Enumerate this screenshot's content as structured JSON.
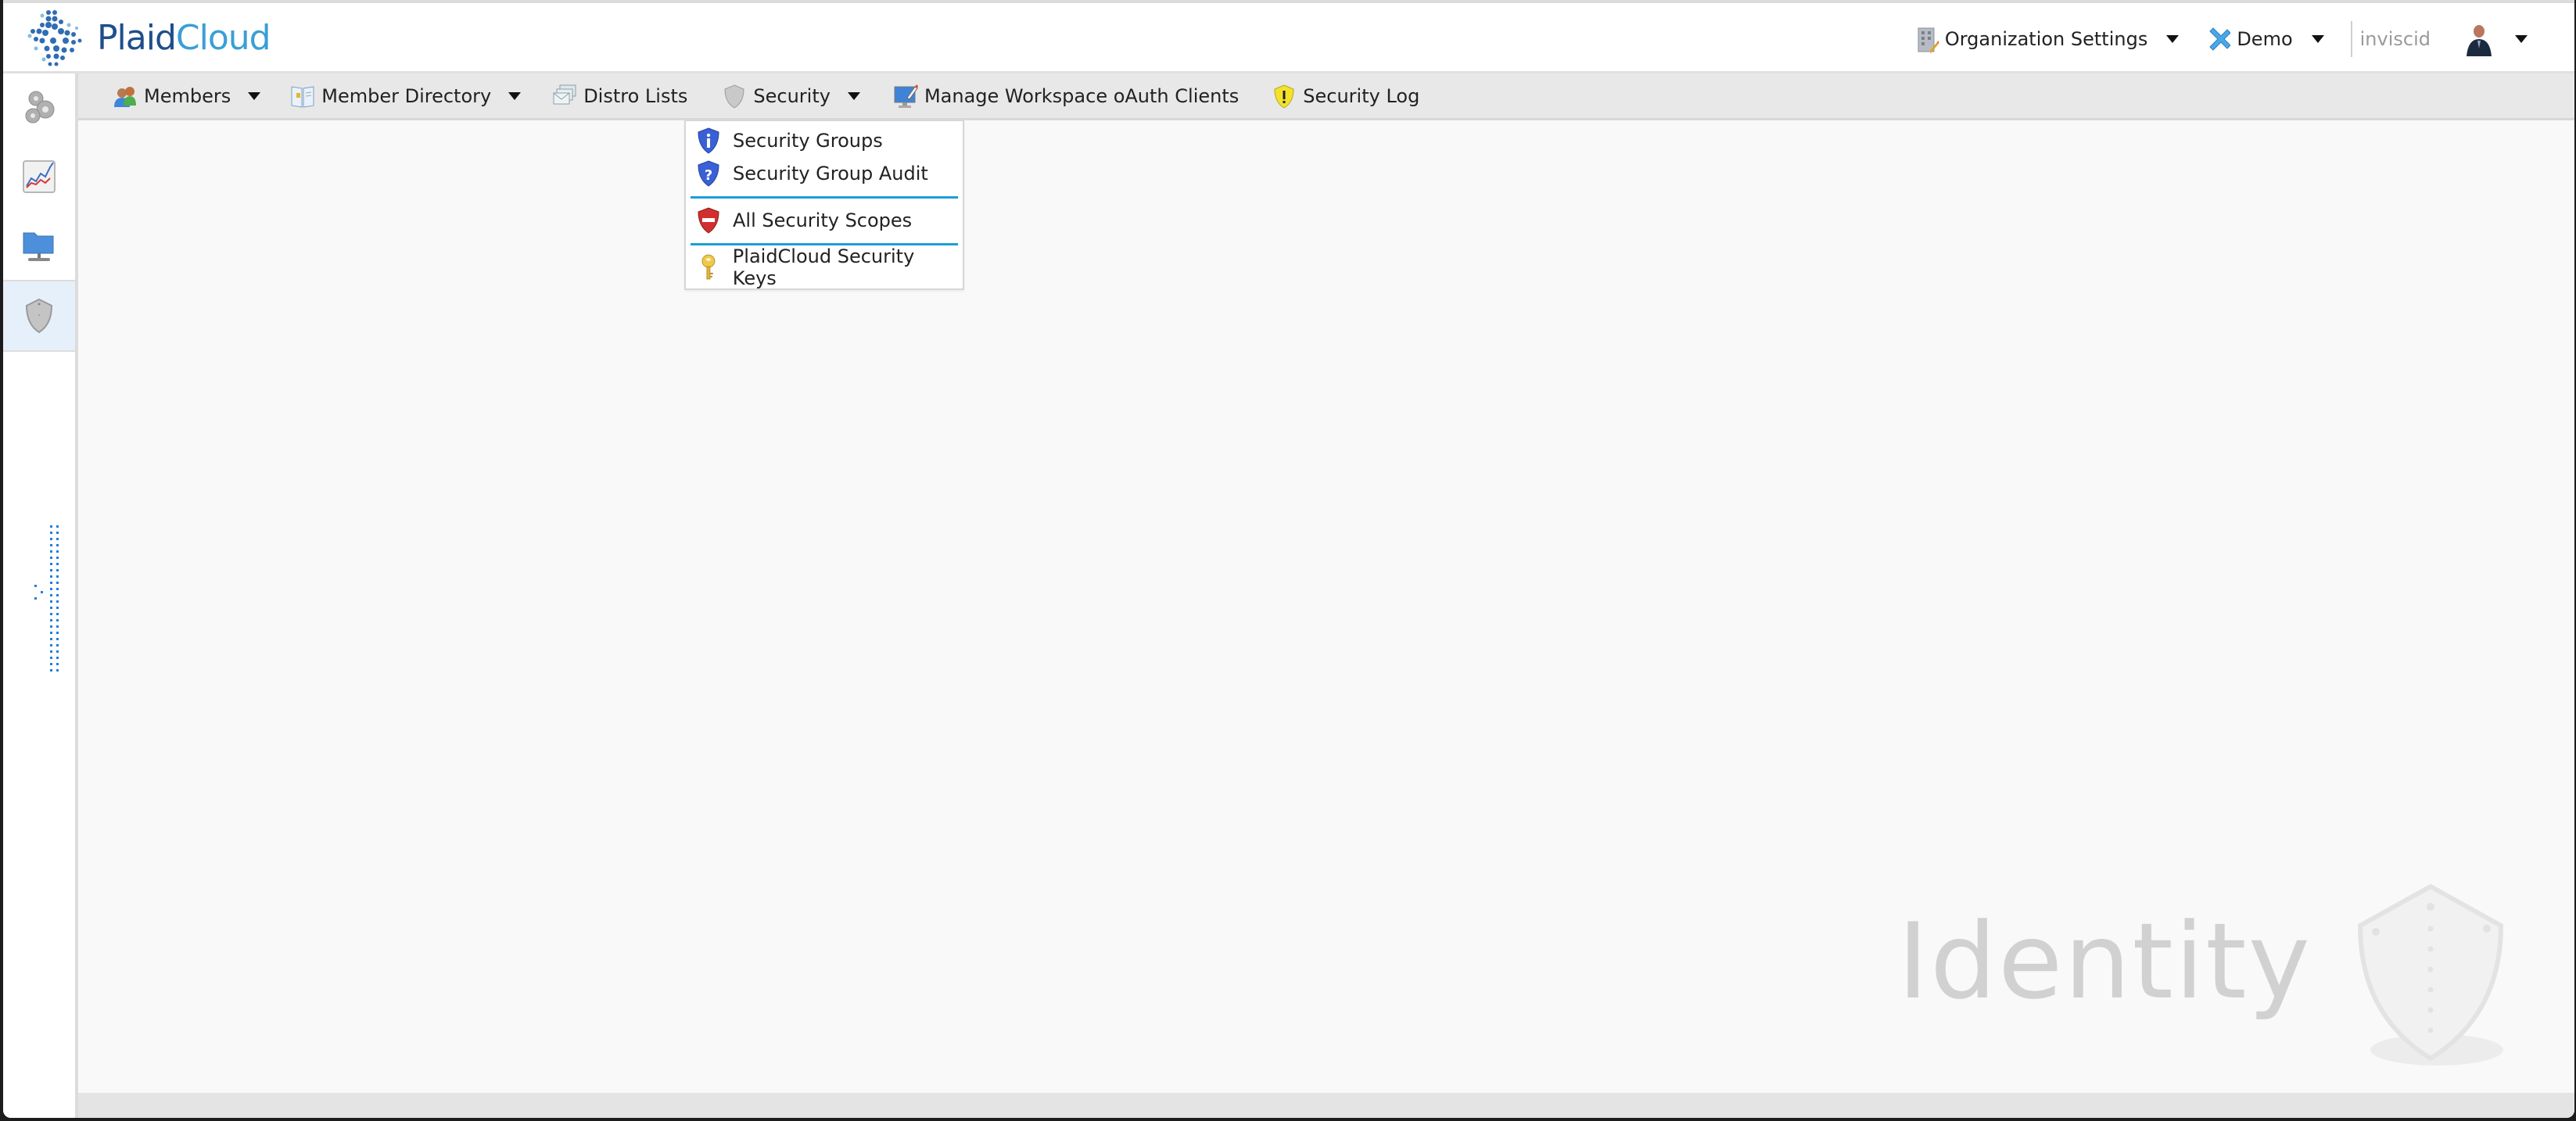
{
  "header": {
    "logo": {
      "part1": "Plaid",
      "part2": "Cloud",
      "icon": "plaidcloud-logo-icon"
    },
    "org_settings": {
      "label": "Organization Settings",
      "icon": "building-edit-icon"
    },
    "workspace": {
      "label": "Demo",
      "icon": "workspace-icon"
    },
    "user": {
      "name": "inviscid",
      "avatar": "user-avatar"
    }
  },
  "sidebar": {
    "items": [
      {
        "name": "settings",
        "icon": "gears-icon",
        "active": false
      },
      {
        "name": "analytics",
        "icon": "chart-icon",
        "active": false
      },
      {
        "name": "document",
        "icon": "network-folder-icon",
        "active": false
      },
      {
        "name": "identity",
        "icon": "shield-icon",
        "active": true
      }
    ]
  },
  "toolbar": {
    "items": [
      {
        "label": "Members",
        "icon": "members-icon",
        "has_menu": true
      },
      {
        "label": "Member Directory",
        "icon": "directory-book-icon",
        "has_menu": true
      },
      {
        "label": "Distro Lists",
        "icon": "mail-stack-icon",
        "has_menu": false
      },
      {
        "label": "Security",
        "icon": "shield-icon",
        "has_menu": true
      },
      {
        "label": "Manage Workspace oAuth Clients",
        "icon": "monitor-edit-icon",
        "has_menu": false
      },
      {
        "label": "Security Log",
        "icon": "shield-warning-icon",
        "has_menu": false
      }
    ]
  },
  "security_menu": {
    "groups": [
      [
        {
          "label": "Security Groups",
          "icon": "shield-info-icon"
        },
        {
          "label": "Security Group Audit",
          "icon": "shield-question-icon"
        }
      ],
      [
        {
          "label": "All Security Scopes",
          "icon": "shield-blocked-icon"
        }
      ],
      [
        {
          "label": "PlaidCloud Security Keys",
          "icon": "key-icon"
        }
      ]
    ]
  },
  "content": {
    "watermark": "Identity"
  },
  "colors": {
    "accent": "#1a9fd9",
    "logo_dark": "#1f4e8c",
    "logo_light": "#3a9fd6",
    "toolbar_bg": "#e8e8e8",
    "content_bg": "#f9f9f9"
  }
}
